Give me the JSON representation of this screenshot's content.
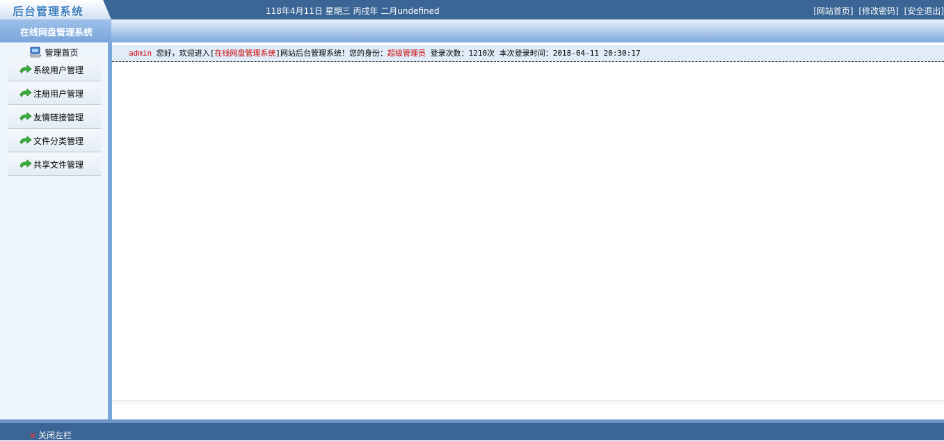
{
  "header": {
    "logo_text": "后台管理系统",
    "date_text": "118年4月11日 星期三 丙戌年 二月undefined",
    "links": {
      "home": "[网站首页]",
      "change_password": "[修改密码]",
      "logout": "[安全退出]"
    }
  },
  "subheader": {
    "system_title": "在线网盘管理系统"
  },
  "sidebar": {
    "home_label": "管理首页",
    "items": [
      {
        "label": "系统用户管理",
        "icon": "green-arrow-icon"
      },
      {
        "label": "注册用户管理",
        "icon": "green-arrow-icon"
      },
      {
        "label": "友情链接管理",
        "icon": "green-arrow-icon"
      },
      {
        "label": "文件分类管理",
        "icon": "green-arrow-icon"
      },
      {
        "label": "共享文件管理",
        "icon": "green-arrow-icon"
      }
    ]
  },
  "welcome": {
    "username": "admin",
    "greeting": " 您好，欢迎进入[",
    "site_name": "在线网盘管理系统",
    "after_site": "]网站后台管理系统！您的身份：",
    "role": "超级管理员",
    "login_count_label": " 登录次数：",
    "login_count": "1210",
    "login_count_unit": "次",
    "last_login_label": " 本次登录时间：",
    "last_login_time": "2018-04-11 20:30:17"
  },
  "footer": {
    "close_sidebar_icon": "×",
    "close_sidebar_label": "关闭左栏"
  },
  "colors": {
    "header_bg": "#3a6595",
    "accent_red": "#cc0000",
    "sidebar_bg": "#eef5fc",
    "welcome_bg": "#e1ecf8"
  }
}
